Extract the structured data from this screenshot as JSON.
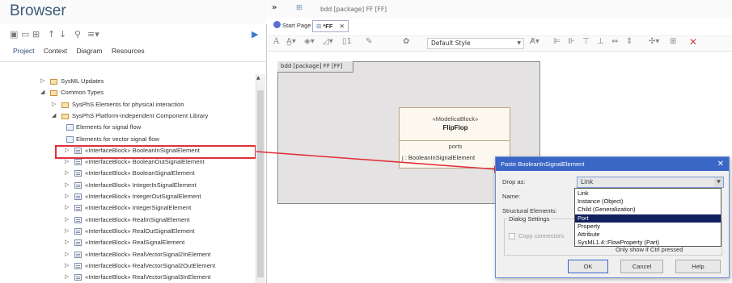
{
  "browser": {
    "title": "Browser",
    "window_controls": "▾ ⊣ ✕",
    "tabs": [
      "Project",
      "Context",
      "Diagram",
      "Resources"
    ],
    "tree": [
      {
        "label": "SysML Updates",
        "indent": 1,
        "expander": "▷",
        "icon": "folder"
      },
      {
        "label": "Common Types",
        "indent": 1,
        "expander": "◢",
        "icon": "folder"
      },
      {
        "label": "SysPhS Elements for physical interaction",
        "indent": 2,
        "expander": "▷",
        "icon": "folder"
      },
      {
        "label": "SysPhS Platform-independent Component Library",
        "indent": 2,
        "expander": "◢",
        "icon": "folder"
      },
      {
        "label": "Elements for signal flow",
        "indent": 3,
        "expander": "",
        "icon": "pkg"
      },
      {
        "label": "Elements for vector signal flow",
        "indent": 3,
        "expander": "",
        "icon": "pkg"
      },
      {
        "label": "«InterfaceBlock» BooleanInSignalElement",
        "indent": 3,
        "expander": "▷",
        "icon": "ib"
      },
      {
        "label": "«InterfaceBlock» BooleanOutSignalElement",
        "indent": 3,
        "expander": "▷",
        "icon": "ib"
      },
      {
        "label": "«InterfaceBlock» BooleanSignalElement",
        "indent": 3,
        "expander": "▷",
        "icon": "ib"
      },
      {
        "label": "«InterfaceBlock» IntegerInSignalElement",
        "indent": 3,
        "expander": "▷",
        "icon": "ib"
      },
      {
        "label": "«InterfaceBlock» IntegerOutSignalElement",
        "indent": 3,
        "expander": "▷",
        "icon": "ib"
      },
      {
        "label": "«InterfaceBlock» IntegerSignalElement",
        "indent": 3,
        "expander": "▷",
        "icon": "ib"
      },
      {
        "label": "«InterfaceBlock» RealInSignalElement",
        "indent": 3,
        "expander": "▷",
        "icon": "ib"
      },
      {
        "label": "«InterfaceBlock» RealOutSignalElement",
        "indent": 3,
        "expander": "▷",
        "icon": "ib"
      },
      {
        "label": "«InterfaceBlock» RealSignalElement",
        "indent": 3,
        "expander": "▷",
        "icon": "ib"
      },
      {
        "label": "«InterfaceBlock» RealVectorSignal2InElement",
        "indent": 3,
        "expander": "▷",
        "icon": "ib"
      },
      {
        "label": "«InterfaceBlock» RealVectorSignal2OutElement",
        "indent": 3,
        "expander": "▷",
        "icon": "ib"
      },
      {
        "label": "«InterfaceBlock» RealVectorSignal3InElement",
        "indent": 3,
        "expander": "▷",
        "icon": "ib"
      }
    ]
  },
  "diagram": {
    "window_title": "bdd [package] FF [FF]",
    "tabs": {
      "start": "Start Page",
      "ff": "*FF"
    },
    "tab_close": "✕",
    "style_select": "Default Style",
    "frame_label": "bdd [package] FF [FF]",
    "block": {
      "stereotype": "«ModelicaBlock»",
      "name": "FlipFlop",
      "compartment": "ports",
      "port": "j : BooleanInSignalElement"
    }
  },
  "dialog": {
    "title": "Paste BooleanInSignalElement",
    "close": "✕",
    "drop_as_label": "Drop as:",
    "drop_as_value": "Link",
    "name_label": "Name:",
    "structural_label": "Structural Elements:",
    "group_label": "Dialog Settings",
    "copy_connectors": "Copy connectors",
    "show_pressed": "Only show if Ctrl pressed",
    "options": [
      "Link",
      "Instance (Object)",
      "Child (Generalization)",
      "Port",
      "Property",
      "Attribute",
      "SysML1.4::FlowProperty (Part)"
    ],
    "selected_option": "Port",
    "buttons": {
      "ok": "OK",
      "cancel": "Cancel",
      "help": "Help"
    }
  },
  "colors": {
    "highlight": "#e0303a",
    "selection": "#12205e",
    "title_bar": "#3a66c6"
  }
}
